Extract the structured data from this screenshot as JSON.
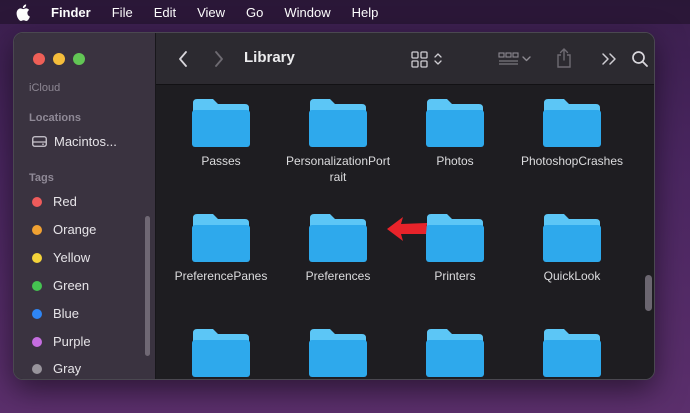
{
  "menubar": {
    "app": "Finder",
    "items": [
      "File",
      "Edit",
      "View",
      "Go",
      "Window",
      "Help"
    ]
  },
  "sidebar": {
    "faded_top": "iCloud",
    "locations_header": "Locations",
    "disk_label": "Macintos...",
    "tags_header": "Tags",
    "tags": [
      {
        "label": "Red",
        "color": "#ee5b5b"
      },
      {
        "label": "Orange",
        "color": "#f0a132"
      },
      {
        "label": "Yellow",
        "color": "#f4d33a"
      },
      {
        "label": "Green",
        "color": "#45c351"
      },
      {
        "label": "Blue",
        "color": "#2f86f5"
      },
      {
        "label": "Purple",
        "color": "#c56de0"
      },
      {
        "label": "Gray",
        "color": "#98949c"
      }
    ]
  },
  "toolbar": {
    "title": "Library",
    "icons": [
      "back-icon",
      "forward-icon",
      "view-grid-icon",
      "group-icon",
      "share-icon",
      "more-icon",
      "search-icon"
    ]
  },
  "folders": [
    {
      "label": "Passes"
    },
    {
      "label": "PersonalizationPortrait"
    },
    {
      "label": "Photos"
    },
    {
      "label": "PhotoshopCrashes"
    },
    {
      "label": "PreferencePanes"
    },
    {
      "label": "Preferences"
    },
    {
      "label": "Printers"
    },
    {
      "label": "QuickLook"
    },
    {
      "label": ""
    },
    {
      "label": ""
    },
    {
      "label": ""
    },
    {
      "label": ""
    }
  ],
  "colors": {
    "folder_top": "#58c3f5",
    "folder_body": "#2fa8ec",
    "annotation_arrow": "#e8232a"
  }
}
